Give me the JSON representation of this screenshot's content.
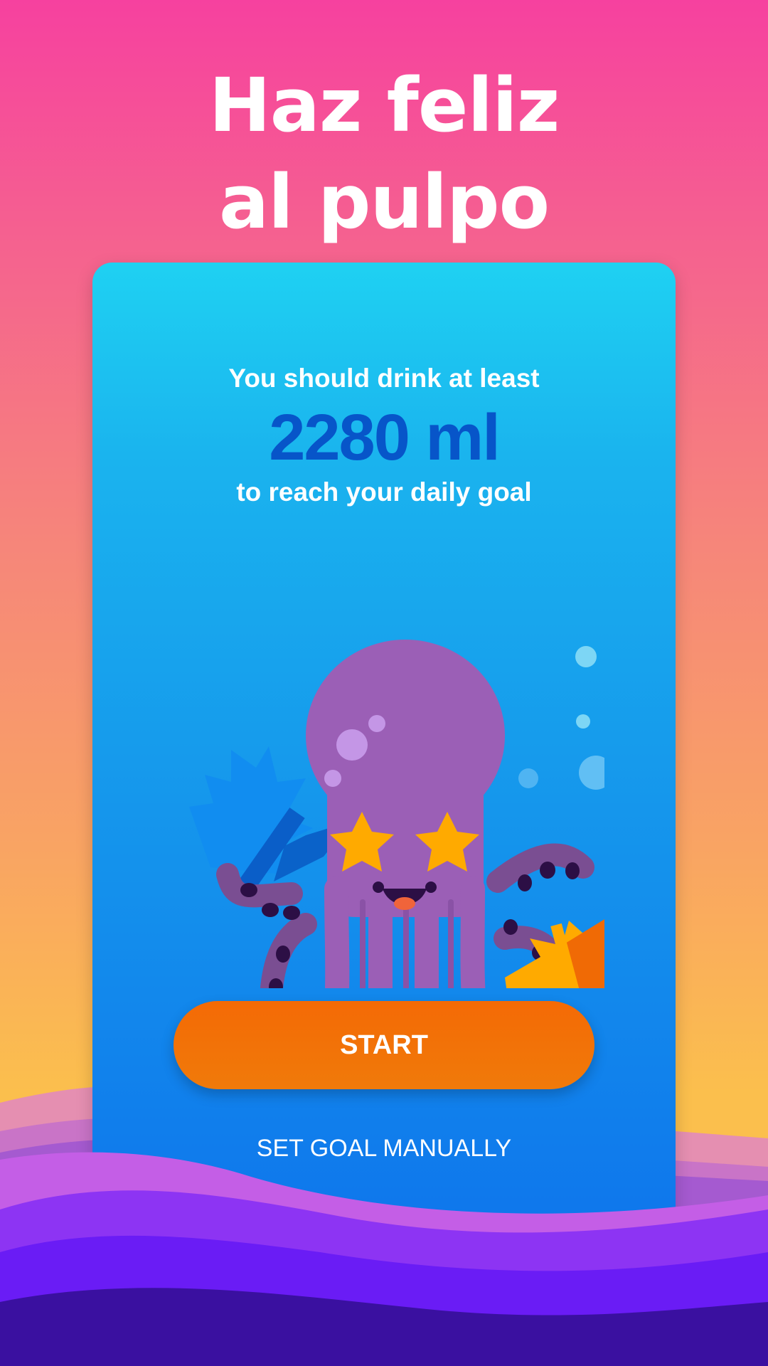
{
  "headline": {
    "line1": "Haz feliz",
    "line2": "al pulpo"
  },
  "card": {
    "intro": "You should drink at least",
    "amount": "2280 ml",
    "outro": "to reach your daily goal"
  },
  "actions": {
    "start_label": "START",
    "manual_label": "SET GOAL MANUALLY"
  },
  "illustration": {
    "icon": "octopus-icon",
    "eyes": "star-eyes",
    "accessories": [
      "blue-leaf-icon",
      "orange-leaf-icon",
      "bubbles"
    ]
  },
  "colors": {
    "background_top": "#f6419f",
    "background_bottom": "#fbbf4d",
    "card_top": "#1fd1f2",
    "card_bottom": "#0e74ec",
    "amount": "#0755c9",
    "button": "#f46a05",
    "octopus": "#9b5fb6",
    "waves": "#6a1cf5"
  }
}
